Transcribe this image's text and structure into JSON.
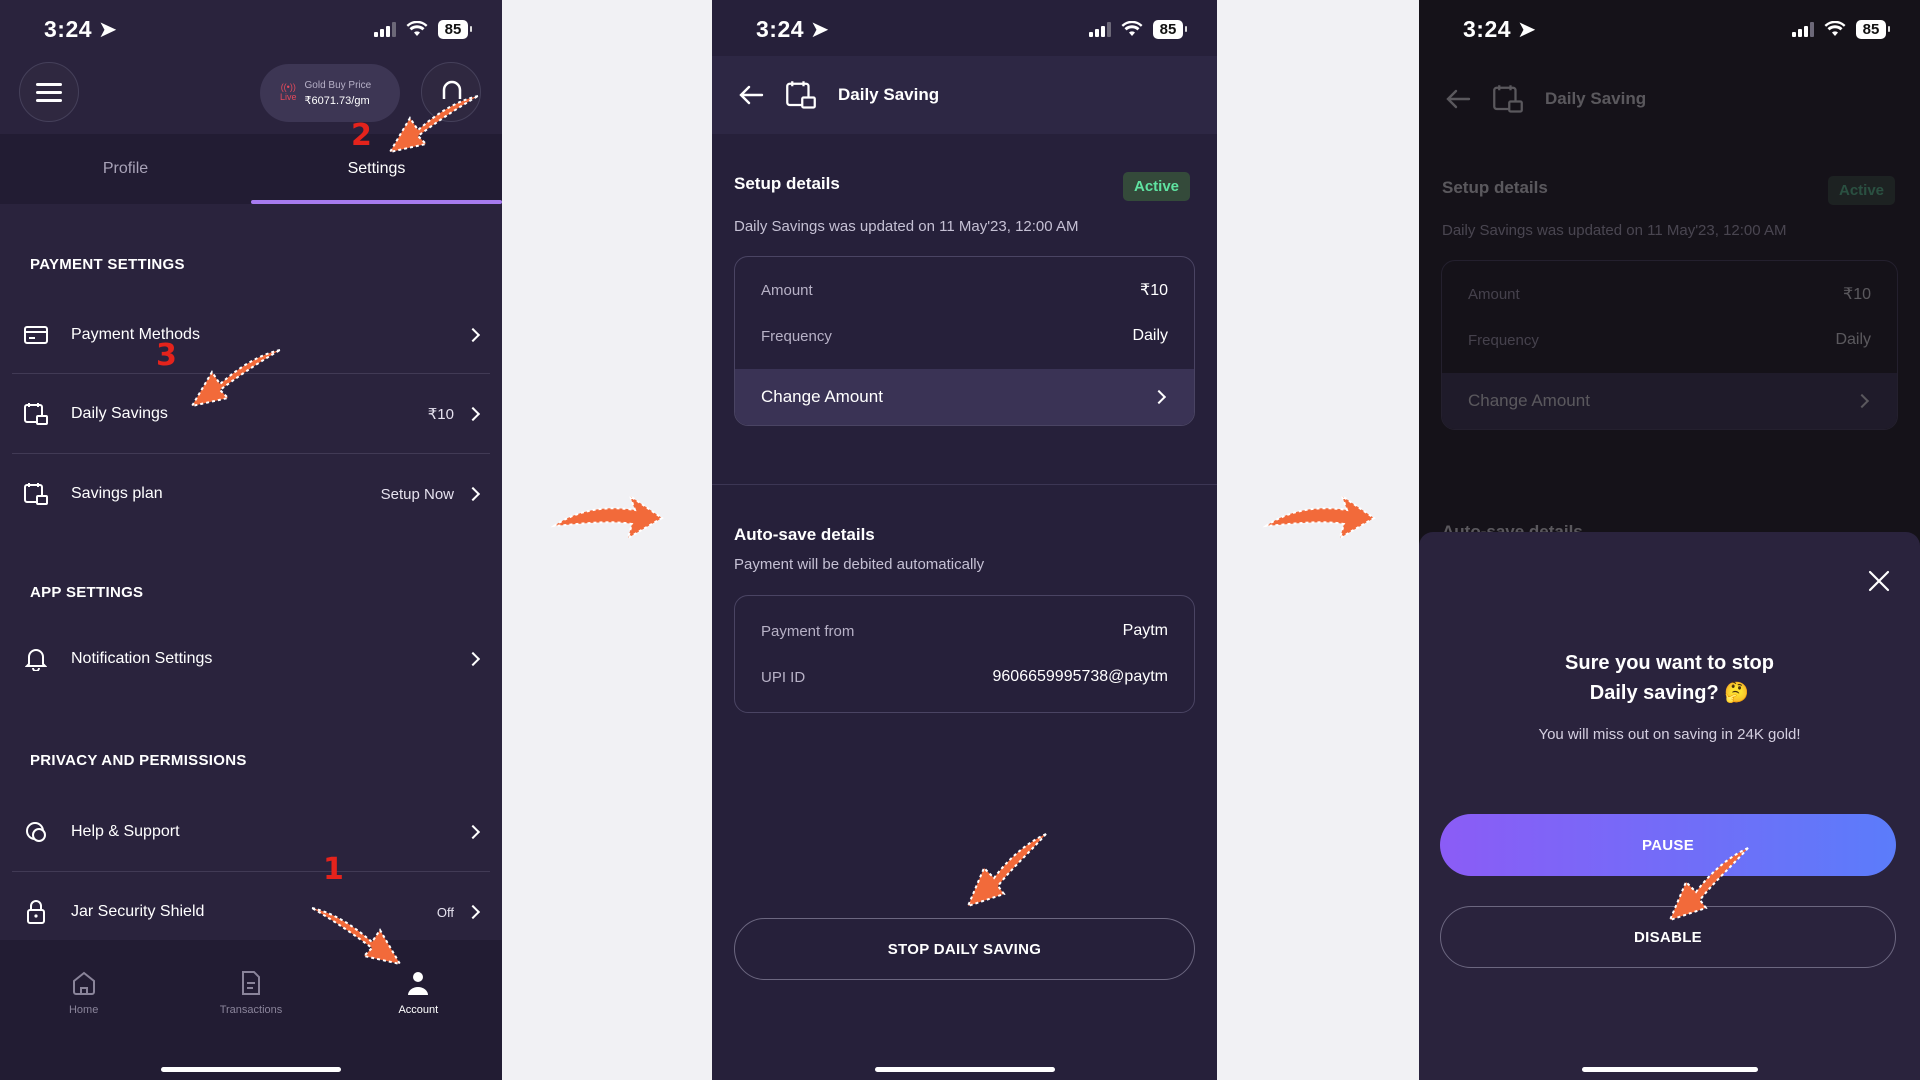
{
  "status_time": "3:24",
  "battery": "85",
  "screen1": {
    "gold_chip": {
      "live": "Live",
      "label": "Gold Buy Price",
      "value": "₹6071.73/gm"
    },
    "tabs": [
      {
        "label": "Profile"
      },
      {
        "label": "Settings"
      }
    ],
    "payment_settings": {
      "title": "PAYMENT SETTINGS",
      "items": [
        {
          "label": "Payment Methods",
          "meta": ""
        },
        {
          "label": "Daily Savings",
          "meta": "₹10"
        },
        {
          "label": "Savings plan",
          "meta": "Setup Now"
        }
      ]
    },
    "app_settings": {
      "title": "APP SETTINGS",
      "items": [
        {
          "label": "Notification Settings"
        }
      ]
    },
    "privacy": {
      "title": "PRIVACY AND PERMISSIONS",
      "items": [
        {
          "label": "Help & Support",
          "meta": ""
        },
        {
          "label": "Jar Security Shield",
          "meta": "Off"
        }
      ]
    },
    "bottom_nav": [
      {
        "label": "Home"
      },
      {
        "label": "Transactions"
      },
      {
        "label": "Account"
      }
    ]
  },
  "screen2": {
    "title": "Daily Saving",
    "setup_title": "Setup details",
    "status_badge": "Active",
    "updated_text": "Daily Savings was updated on 11 May'23, 12:00 AM",
    "amount_label": "Amount",
    "amount_value": "₹10",
    "frequency_label": "Frequency",
    "frequency_value": "Daily",
    "change_amount": "Change Amount",
    "autosave_title": "Auto-save details",
    "autosave_sub": "Payment will be debited automatically",
    "payment_from_label": "Payment from",
    "payment_from_value": "Paytm",
    "upi_label": "UPI ID",
    "upi_value": "9606659995738@paytm",
    "stop_button": "STOP DAILY SAVING"
  },
  "screen3": {
    "peek_title": "Auto-save details",
    "dialog_title_line1": "Sure you want to stop",
    "dialog_title_line2": "Daily saving? 🤔",
    "dialog_sub": "You will miss out on saving in 24K gold!",
    "pause_button": "PAUSE",
    "disable_button": "DISABLE"
  },
  "steps": {
    "one": "1",
    "two": "2",
    "three": "3"
  },
  "colors": {
    "accent_purple": "#a77bf0",
    "active_green": "#5fe3a1",
    "pause_gradient_start": "#8b5cf6",
    "pause_gradient_end": "#5b7cfa",
    "arrow_orange": "#f26a3a",
    "step_red": "#e4231c"
  }
}
